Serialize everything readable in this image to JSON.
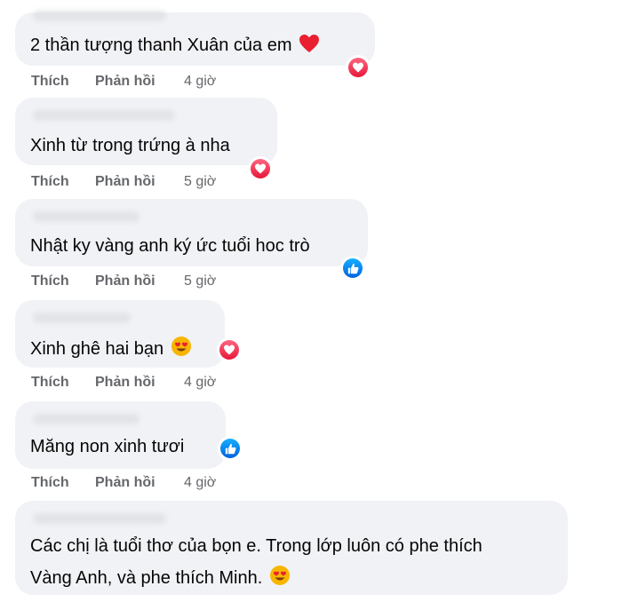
{
  "actions": {
    "like": "Thích",
    "reply": "Phản hồi"
  },
  "comments": [
    {
      "text": "2 thần tượng thanh Xuân của em",
      "reaction": "love-icon",
      "time": "4 giờ"
    },
    {
      "text": "Xinh từ trong trứng à nha",
      "reaction": "love-icon",
      "time": "5 giờ"
    },
    {
      "text": "Nhật ky vàng anh ký ức tuổi hoc trò",
      "reaction": "like-icon",
      "time": "5 giờ"
    },
    {
      "text": "Xinh ghê hai bạn",
      "reaction": "love-icon",
      "time": "4 giờ"
    },
    {
      "text": "Măng non xinh tươi",
      "reaction": "like-icon",
      "time": "4 giờ"
    },
    {
      "text_line1": "Các chị là tuổi thơ của bọn e. Trong lớp luôn có phe thích",
      "text_line2": "Vàng Anh, và phe thích Minh."
    }
  ],
  "colors": {
    "bubble": "#f0f2f5",
    "action_text": "#65676b",
    "love": "#f02849",
    "like": "#1877f2"
  }
}
